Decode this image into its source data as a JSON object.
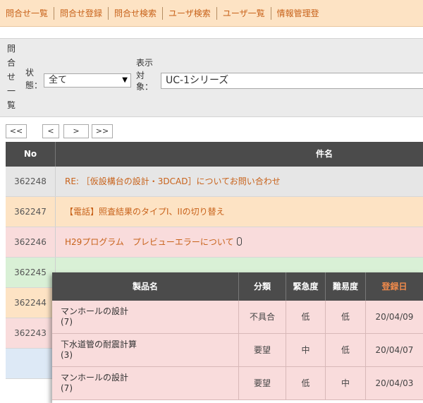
{
  "tabs": [
    "問合せ一覧",
    "問合せ登録",
    "問合せ検索",
    "ユーザ検索",
    "ユーザ一覧",
    "情報管理登"
  ],
  "filter": {
    "list_label_chars": [
      "問",
      "合",
      "せ",
      "一",
      "覧"
    ],
    "status_label_chars": [
      "状",
      "態："
    ],
    "status_value": "全て",
    "target_label_chars": [
      "表示",
      "対",
      "象："
    ],
    "target_value": "UC-1シリーズ"
  },
  "pager": [
    "<<",
    "<",
    ">",
    ">>"
  ],
  "table": {
    "headers": {
      "no": "No",
      "subject": "件名"
    },
    "rows": [
      {
        "no": "362248",
        "subject": "RE: ［仮設構台の設計・3DCAD］についてお問い合わせ",
        "bg": "#e6e6e6",
        "attachment": false
      },
      {
        "no": "362247",
        "subject": "【電話】照査結果のタイプI、IIの切り替え",
        "bg": "#fde3c4",
        "attachment": false
      },
      {
        "no": "362246",
        "subject": "H29プログラム　プレビューエラーについて",
        "bg": "#f9dcdc",
        "attachment": true
      },
      {
        "no": "362245",
        "subject": "",
        "bg": "#d9f0d6",
        "attachment": false
      },
      {
        "no": "362244",
        "subject": "",
        "bg": "#fde3c4",
        "attachment": false
      },
      {
        "no": "362243",
        "subject": "",
        "bg": "#f9dcdc",
        "attachment": false
      },
      {
        "no": "",
        "subject": "",
        "bg": "#dde9f6",
        "attachment": false
      }
    ]
  },
  "popup": {
    "headers": {
      "product": "製品名",
      "category": "分類",
      "urgency": "緊急度",
      "difficulty": "難易度",
      "reg_date": "登録日"
    },
    "rows": [
      {
        "product": "マンホールの設計",
        "count": "(7)",
        "category": "不具合",
        "urgency": "低",
        "difficulty": "低",
        "date": "20/04/09"
      },
      {
        "product": "下水道管の耐震計算",
        "count": "(3)",
        "category": "要望",
        "urgency": "中",
        "difficulty": "低",
        "date": "20/04/07"
      },
      {
        "product": "マンホールの設計",
        "count": "(7)",
        "category": "要望",
        "urgency": "低",
        "difficulty": "中",
        "date": "20/04/03"
      }
    ]
  },
  "colors": {
    "accent": "#c8621a",
    "header_bg": "#4b4b4b",
    "reg_date_header": "#f08a4b"
  }
}
